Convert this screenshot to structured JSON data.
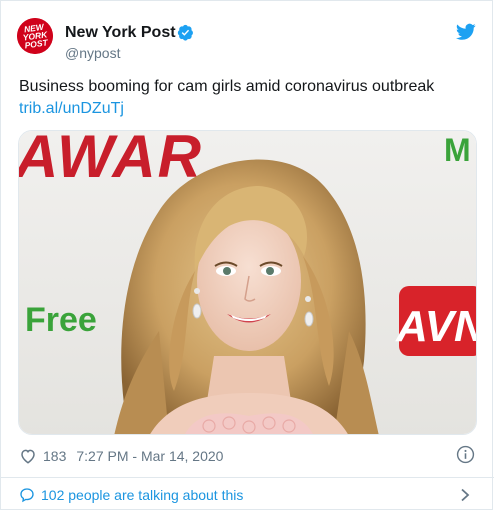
{
  "account": {
    "name": "New York Post",
    "handle": "@nypost",
    "avatar_lines": [
      "NEW",
      "YORK",
      "POST"
    ]
  },
  "tweet": {
    "text": "Business booming for cam girls amid coronavirus outbreak",
    "link": "trib.al/unDZuTj"
  },
  "media": {
    "backdrop_words": [
      "AWAR",
      "Free",
      "AVN",
      "M"
    ]
  },
  "meta": {
    "likes": "183",
    "timestamp": "7:27 PM - Mar 14, 2020"
  },
  "footer": {
    "talking": "102 people are talking about this"
  },
  "colors": {
    "brand_red": "#d0021b",
    "link_blue": "#1b95e0",
    "twitter_blue": "#1da1f2",
    "muted": "#657786"
  },
  "icons": [
    "verified-badge-icon",
    "twitter-bird-icon",
    "heart-icon",
    "info-icon",
    "speech-bubble-icon",
    "chevron-right-icon"
  ]
}
